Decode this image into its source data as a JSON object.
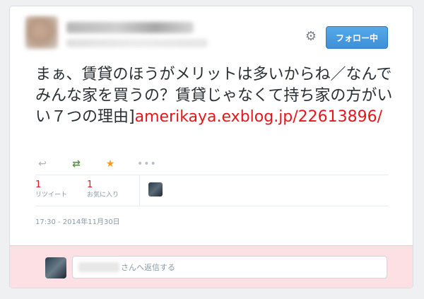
{
  "header": {
    "follow_button_label": "フォロー中"
  },
  "tweet": {
    "text": "まぁ、賃貸のほうがメリットは多いからね／なんでみんな家を買うの？賃貸じゃなくて持ち家の方がいい７つの理由]",
    "link_text": "amerikaya.exblog.jp/22613896/",
    "retweet_count": "1",
    "retweet_label": "リツイート",
    "favorite_count": "1",
    "favorite_label": "お気に入り",
    "timestamp": "17:30 - 2014年11月30日"
  },
  "reply": {
    "placeholder": "さんへ返信する"
  },
  "icons": {
    "settings": "gear-icon",
    "reply": "reply-icon",
    "retweet": "retweet-icon",
    "favorite": "star-icon",
    "more": "more-icon"
  },
  "colors": {
    "link": "#e8151d",
    "follow_button": "#4a9de0",
    "favorite": "#f29d1e",
    "retweet": "#5c913b",
    "reply_bar_bg": "#fde0e4"
  }
}
